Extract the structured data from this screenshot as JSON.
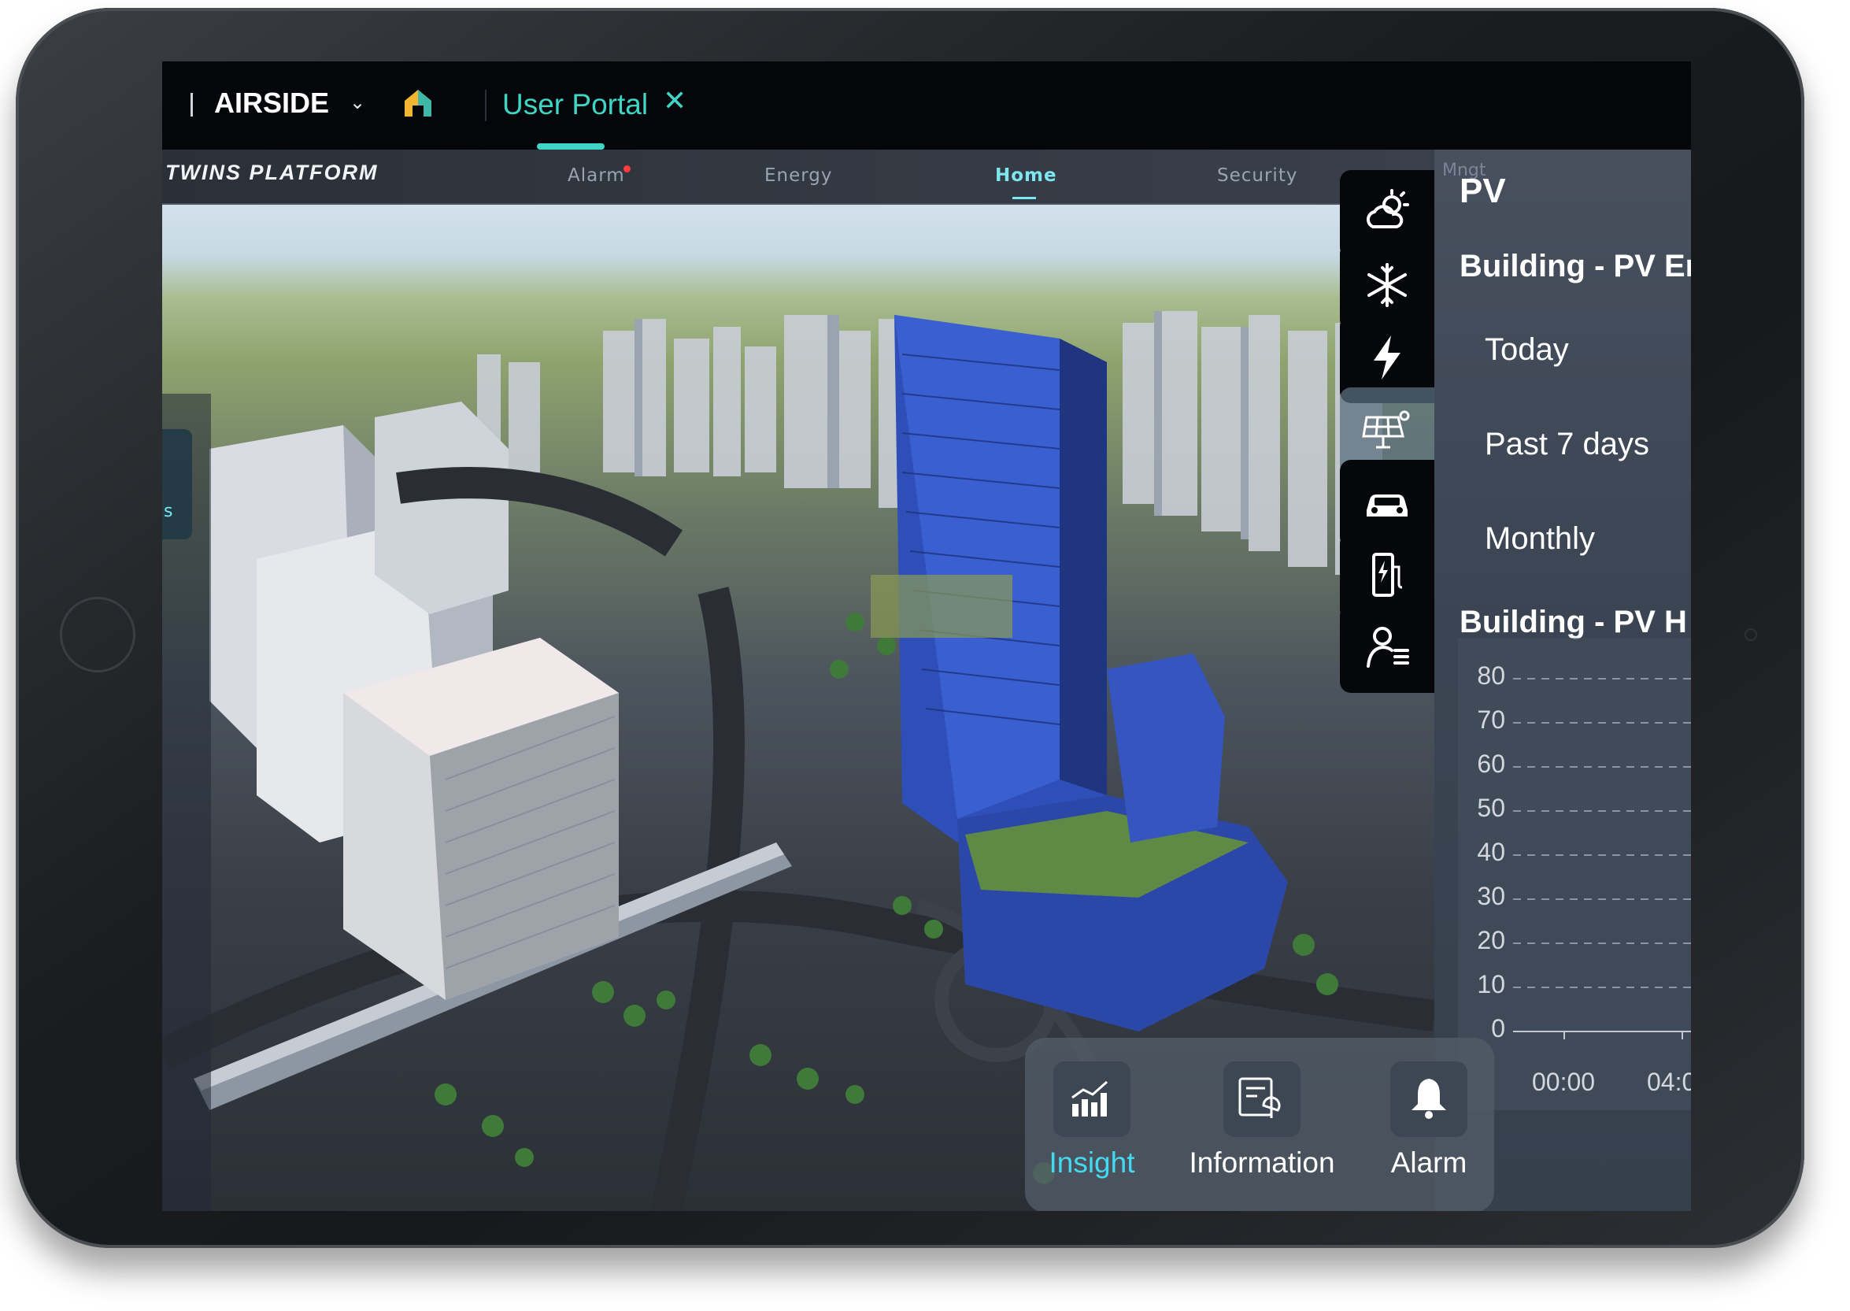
{
  "topbar": {
    "brand": "AIRSIDE",
    "chevron": "⌄",
    "home_icon": "home-icon",
    "tab_label": "User Portal",
    "tab_close": "✕"
  },
  "navstrip": {
    "logo": "TWINS PLATFORM",
    "items": [
      "Alarm",
      "Energy",
      "Home",
      "Security"
    ],
    "active": "Home",
    "faded": "Mngt"
  },
  "left_chip": {
    "label": "s"
  },
  "side_icons": [
    "weather-icon",
    "snowflake-icon",
    "lightning-icon",
    "solar-panel-icon",
    "car-icon",
    "ev-charger-icon",
    "user-list-icon"
  ],
  "pv_panel": {
    "title": "PV",
    "section1": "Building - PV En",
    "options": [
      "Today",
      "Past 7 days",
      "Monthly"
    ],
    "section2": "Building - PV H",
    "chart": {
      "y_ticks": [
        "80",
        "70",
        "60",
        "50",
        "40",
        "30",
        "20",
        "10",
        "0"
      ],
      "x_ticks": [
        "00:00",
        "04:0"
      ]
    }
  },
  "dock": {
    "items": [
      {
        "label": "Insight",
        "icon": "insight-chart-icon",
        "active": true
      },
      {
        "label": "Information",
        "icon": "information-icon",
        "active": false
      },
      {
        "label": "Alarm",
        "icon": "bell-icon",
        "active": false
      }
    ]
  },
  "colors": {
    "accent": "#3fd6c6",
    "dock_active": "#45d9f0",
    "alarm_dot": "#ff3b3b"
  }
}
